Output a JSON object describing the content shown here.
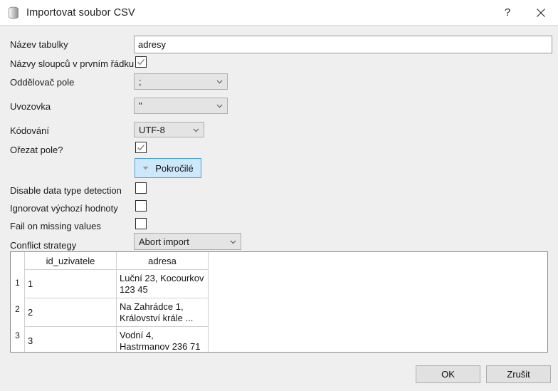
{
  "window": {
    "title": "Importovat soubor CSV",
    "icon": "database-icon",
    "help_label": "?",
    "close_label": "✕",
    "background": "#efefef",
    "titlebar_background": "#ffffff"
  },
  "form": {
    "table_name": {
      "label": "Název tabulky",
      "value": "adresy",
      "placeholder": ""
    },
    "header_row": {
      "label": "Názvy sloupců v prvním řádku",
      "checked": true
    },
    "delimiter": {
      "label": "Oddělovač pole",
      "value": ";"
    },
    "quote": {
      "label": "Uvozovka",
      "value": "\""
    },
    "encoding": {
      "label": "Kódování",
      "value": "UTF-8"
    },
    "trim": {
      "label": "Ořezat pole?",
      "checked": true
    },
    "advanced_button": {
      "label": "Pokročilé",
      "icon": "chevron-down-icon",
      "accent": "#cde8fa",
      "border": "#4c9fd6"
    },
    "disable_type_detection": {
      "label": "Disable data type detection",
      "checked": false
    },
    "ignore_defaults": {
      "label": "Ignorovat výchozí hodnoty",
      "checked": false
    },
    "fail_missing": {
      "label": "Fail on missing values",
      "checked": false
    },
    "conflict_strategy": {
      "label": "Conflict strategy",
      "value": "Abort import"
    }
  },
  "preview": {
    "columns": [
      "id_uzivatele",
      "adresa"
    ],
    "row_numbers": [
      "1",
      "2",
      "3"
    ],
    "rows": [
      [
        "1",
        "Luční 23, Kocourkov 123 45"
      ],
      [
        "2",
        "Na Zahrádce 1, Království krále ..."
      ],
      [
        "3",
        "Vodní 4, Hastrmanov 236 71"
      ]
    ]
  },
  "footer": {
    "ok_label": "OK",
    "cancel_label": "Zrušit"
  }
}
